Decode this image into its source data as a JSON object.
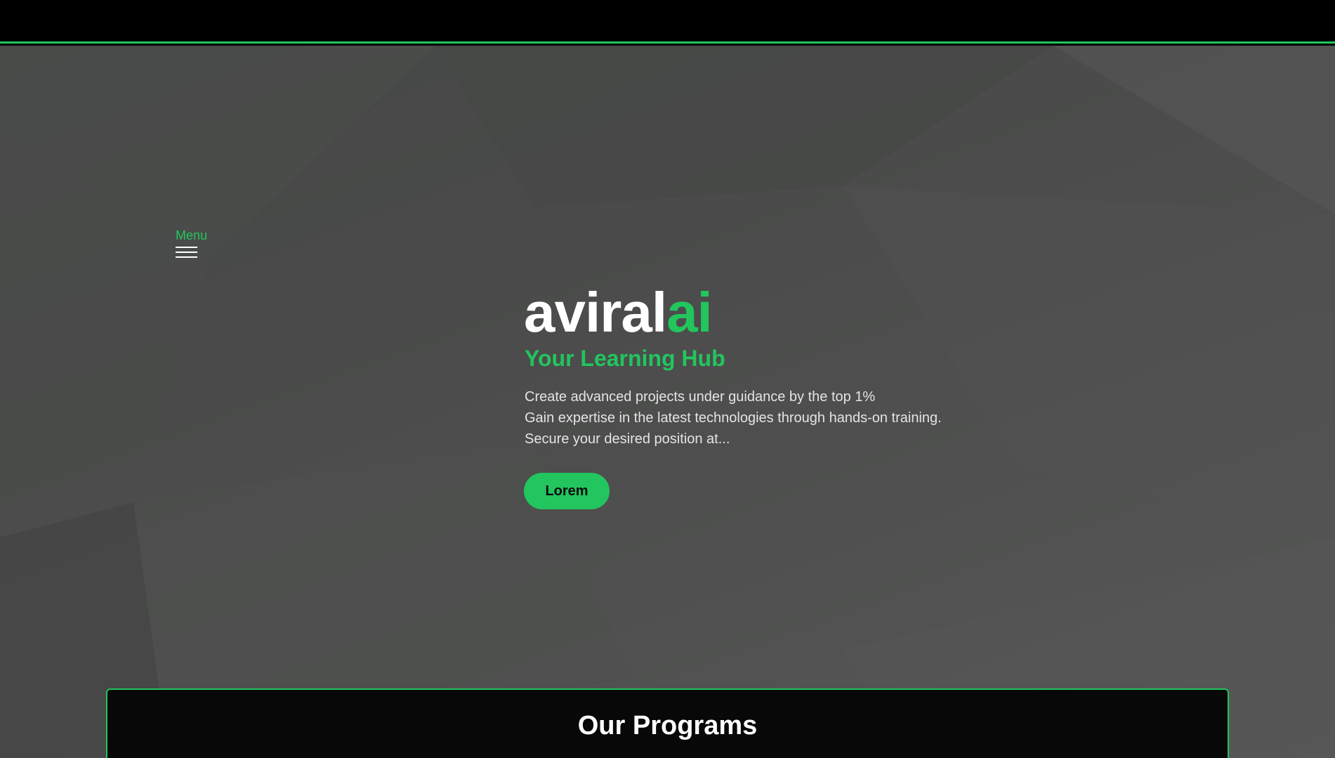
{
  "colors": {
    "accent": "#22c55e",
    "topbar": "#000000",
    "hero_background": "#4a4b4a",
    "panel_background": "#070807",
    "text_primary": "#ffffff",
    "text_secondary": "#e4e4e4"
  },
  "nav": {
    "menu_label": "Menu",
    "menu_icon": "hamburger-icon"
  },
  "hero": {
    "brand_main": "aviral",
    "brand_accent": "ai",
    "tagline": "Your Learning Hub",
    "description": [
      "Create advanced projects under guidance by the top 1%",
      "Gain expertise in the latest technologies through hands-on training.",
      "Secure your desired position at..."
    ],
    "cta_label": "Lorem"
  },
  "programs": {
    "title": "Our Programs"
  }
}
